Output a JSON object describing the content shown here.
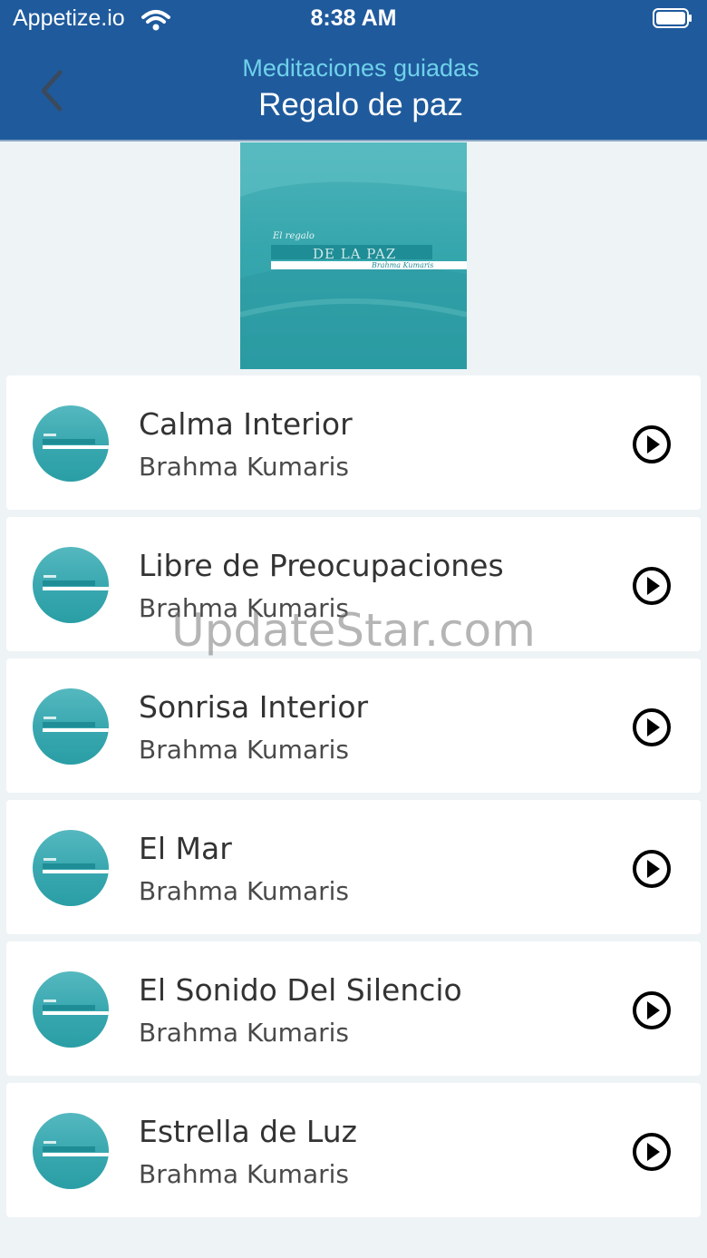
{
  "status_bar": {
    "carrier": "Appetize.io",
    "time": "8:38 AM"
  },
  "header": {
    "subtitle": "Meditaciones guiadas",
    "title": "Regalo de paz",
    "accent_color": "#1f5a9c",
    "subtitle_color": "#6fd1ea"
  },
  "cover": {
    "small_text": "El regalo",
    "band_text": "DE LA PAZ",
    "author_text": "Brahma Kumaris"
  },
  "tracks": [
    {
      "title": "Calma Interior",
      "author": "Brahma Kumaris",
      "icon": "play-circle-icon"
    },
    {
      "title": "Libre de Preocupaciones",
      "author": "Brahma Kumaris",
      "icon": "play-circle-icon"
    },
    {
      "title": "Sonrisa Interior",
      "author": "Brahma Kumaris",
      "icon": "play-circle-icon"
    },
    {
      "title": "El Mar",
      "author": "Brahma Kumaris",
      "icon": "play-circle-icon"
    },
    {
      "title": "El Sonido Del Silencio",
      "author": "Brahma Kumaris",
      "icon": "play-circle-icon"
    },
    {
      "title": "Estrella de Luz",
      "author": "Brahma Kumaris",
      "icon": "play-circle-icon"
    }
  ],
  "watermark": "UpdateStar.com"
}
